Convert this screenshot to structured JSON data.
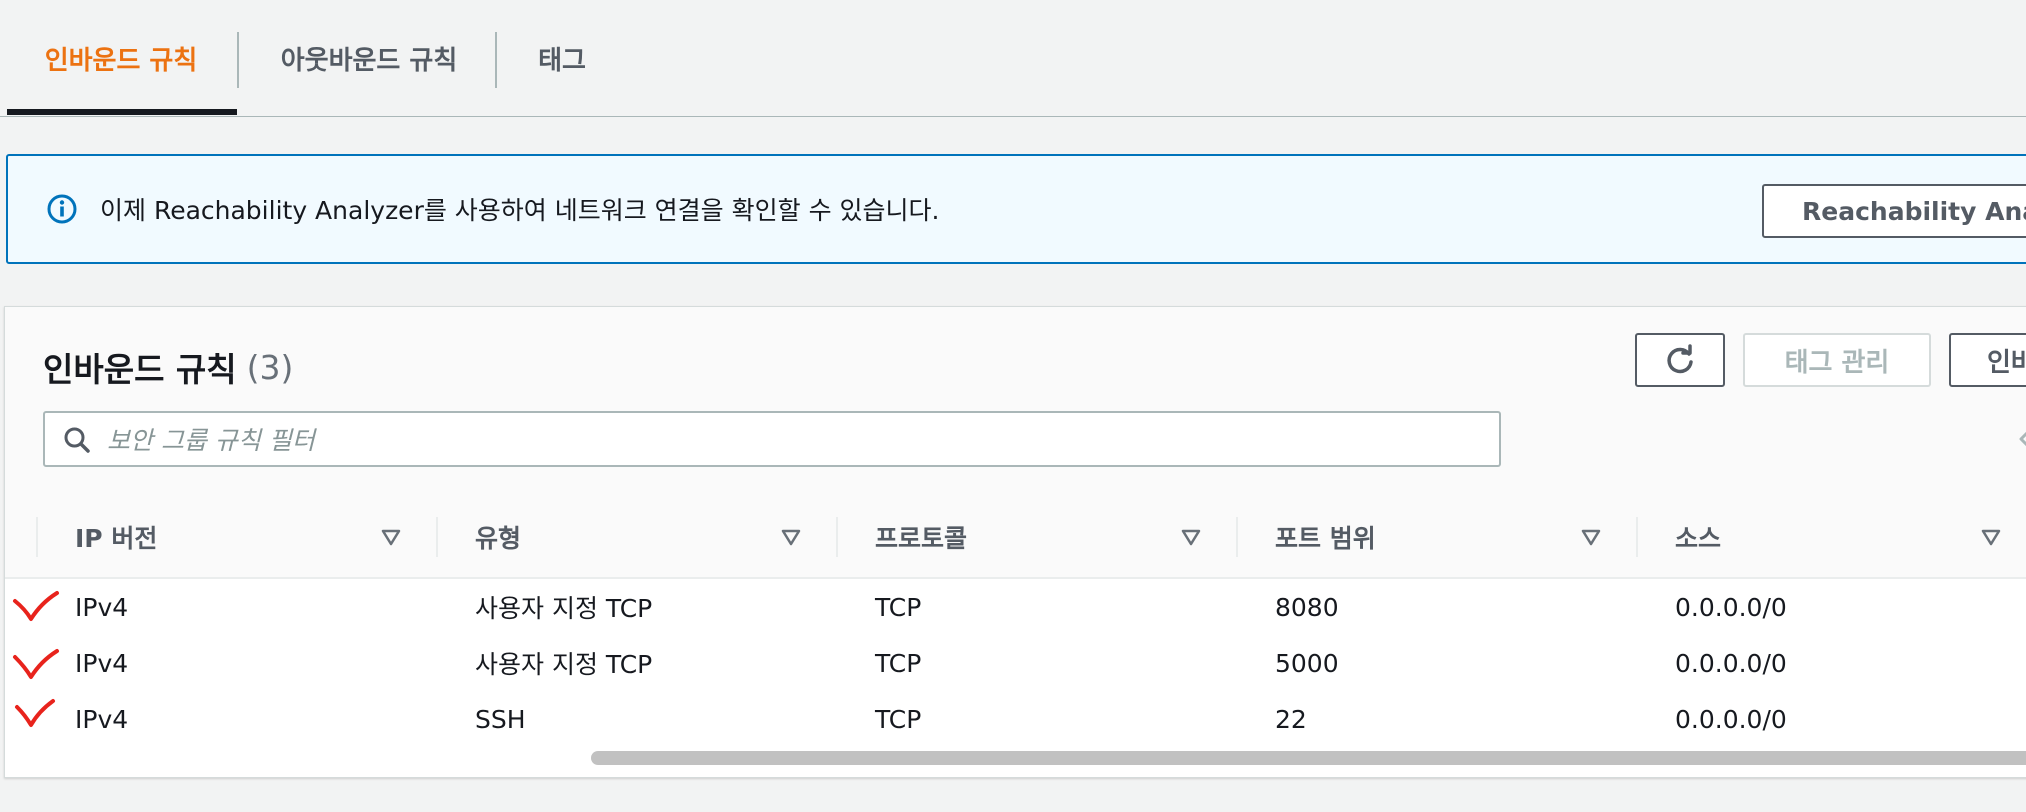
{
  "tabs": [
    {
      "label": "인바운드 규칙",
      "active": true
    },
    {
      "label": "아웃바운드 규칙",
      "active": false
    },
    {
      "label": "태그",
      "active": false
    }
  ],
  "alert": {
    "icon": "info-icon",
    "text": "이제 Reachability Analyzer를 사용하여 네트워크 연결을 확인할 수 있습니다.",
    "button_label": "Reachability Analyzer"
  },
  "rules_panel": {
    "title": "인바운드 규칙",
    "count": "(3)",
    "refresh_icon": "refresh-icon",
    "manage_tags_label": "태그 관리",
    "edit_rules_label": "인바운드 규칙 편집",
    "search": {
      "placeholder": "보안 그룹 규칙 필터",
      "value": ""
    }
  },
  "table": {
    "columns": [
      "IP 버전",
      "유형",
      "프로토콜",
      "포트 범위",
      "소스"
    ],
    "rows": [
      {
        "ip_version": "IPv4",
        "type": "사용자 지정 TCP",
        "protocol": "TCP",
        "port_range": "8080",
        "source": "0.0.0.0/0"
      },
      {
        "ip_version": "IPv4",
        "type": "사용자 지정 TCP",
        "protocol": "TCP",
        "port_range": "5000",
        "source": "0.0.0.0/0"
      },
      {
        "ip_version": "IPv4",
        "type": "SSH",
        "protocol": "TCP",
        "port_range": "22",
        "source": "0.0.0.0/0"
      }
    ]
  },
  "colors": {
    "accent": "#ec7211",
    "info_border": "#0073bb",
    "annotation": "#e8231c"
  }
}
